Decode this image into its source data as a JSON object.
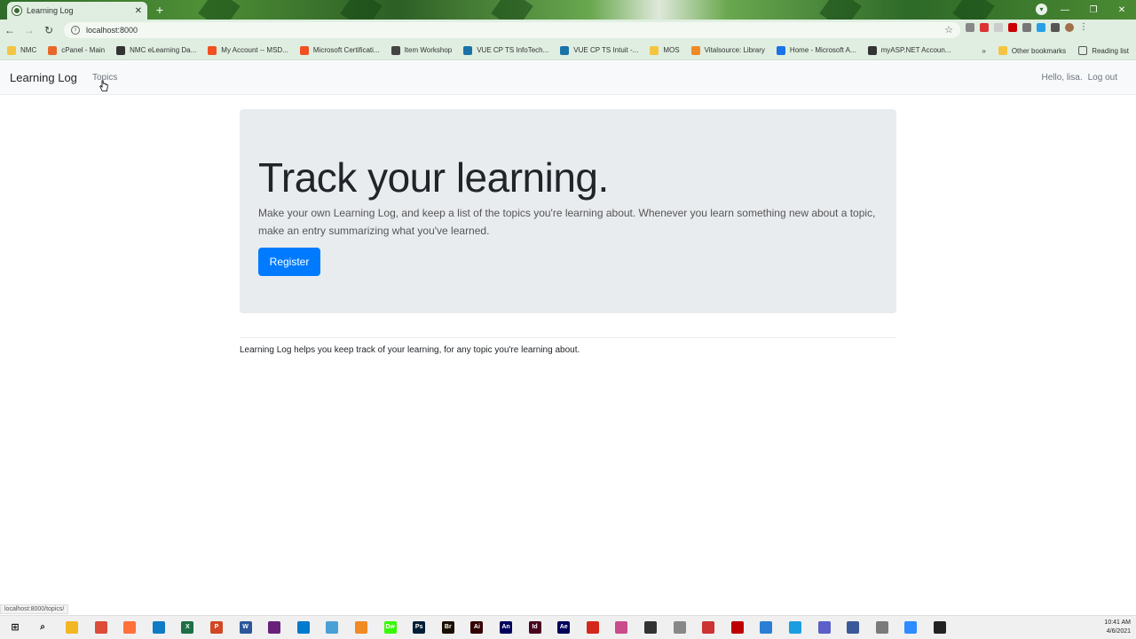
{
  "browser": {
    "tab_title": "Learning Log",
    "tab_close": "✕",
    "new_tab": "+",
    "url": "localhost:8000",
    "status_url": "localhost:8000/topics/",
    "bookmarks": [
      {
        "label": "NMC",
        "color": "#f4c542"
      },
      {
        "label": "cPanel - Main",
        "color": "#e8682b"
      },
      {
        "label": "NMC eLearning Da...",
        "color": "#333333"
      },
      {
        "label": "My Account -- MSD...",
        "color": "#f25022"
      },
      {
        "label": "Microsoft Certificati...",
        "color": "#f25022"
      },
      {
        "label": "Item Workshop",
        "color": "#444444"
      },
      {
        "label": "VUE CP TS InfoTech...",
        "color": "#1a73a8"
      },
      {
        "label": "VUE CP TS Intuit -...",
        "color": "#1a73a8"
      },
      {
        "label": "MOS",
        "color": "#f4c542"
      },
      {
        "label": "Vitalsource: Library",
        "color": "#f08a24"
      },
      {
        "label": "Home - Microsoft A...",
        "color": "#1a73e8"
      },
      {
        "label": "myASP.NET Accoun...",
        "color": "#333333"
      }
    ],
    "bookmarks_more": "»",
    "other_bookmarks": "Other bookmarks",
    "reading_list": "Reading list"
  },
  "navbar": {
    "brand": "Learning Log",
    "topics": "Topics",
    "greeting": "Hello, lisa.",
    "logout": "Log out"
  },
  "jumbotron": {
    "heading": "Track your learning.",
    "lead": "Make your own Learning Log, and keep a list of the topics you're learning about. Whenever you learn something new about a topic, make an entry summarizing what you've learned.",
    "register": "Register"
  },
  "footer": {
    "text": "Learning Log helps you keep track of your learning, for any topic you're learning about."
  },
  "taskbar": {
    "time": "10:41 AM",
    "date": "4/6/2021",
    "apps": [
      {
        "name": "file-explorer",
        "label": "",
        "color": "#f2b824"
      },
      {
        "name": "chrome",
        "label": "",
        "color": "#dd4b39"
      },
      {
        "name": "firefox",
        "label": "",
        "color": "#ff7139"
      },
      {
        "name": "edge",
        "label": "",
        "color": "#0f7bc4"
      },
      {
        "name": "excel",
        "label": "X",
        "color": "#1d7044"
      },
      {
        "name": "powerpoint",
        "label": "P",
        "color": "#d24726"
      },
      {
        "name": "word",
        "label": "W",
        "color": "#2b579a"
      },
      {
        "name": "visual-studio",
        "label": "",
        "color": "#68217a"
      },
      {
        "name": "vscode",
        "label": "",
        "color": "#007acc"
      },
      {
        "name": "app-tool",
        "label": "",
        "color": "#4aa0d5"
      },
      {
        "name": "sublime",
        "label": "",
        "color": "#f08a24"
      },
      {
        "name": "dreamweaver",
        "label": "Dw",
        "color": "#35fa00"
      },
      {
        "name": "photoshop",
        "label": "Ps",
        "color": "#001e36"
      },
      {
        "name": "bridge",
        "label": "Br",
        "color": "#1a0e00"
      },
      {
        "name": "illustrator",
        "label": "Ai",
        "color": "#330000"
      },
      {
        "name": "animate",
        "label": "An",
        "color": "#00005b"
      },
      {
        "name": "indesign",
        "label": "Id",
        "color": "#49021f"
      },
      {
        "name": "after-effects",
        "label": "Ae",
        "color": "#00005b"
      },
      {
        "name": "acrobat",
        "label": "",
        "color": "#d4271b"
      },
      {
        "name": "app-2",
        "label": "",
        "color": "#c94c8b"
      },
      {
        "name": "app-3",
        "label": "",
        "color": "#333333"
      },
      {
        "name": "app-4",
        "label": "",
        "color": "#888888"
      },
      {
        "name": "app-5",
        "label": "",
        "color": "#cc3333"
      },
      {
        "name": "filezilla",
        "label": "",
        "color": "#bf0000"
      },
      {
        "name": "app-6",
        "label": "",
        "color": "#2a7fd4"
      },
      {
        "name": "app-7",
        "label": "",
        "color": "#1b9de2"
      },
      {
        "name": "teams",
        "label": "",
        "color": "#5b5fc7"
      },
      {
        "name": "app-8",
        "label": "",
        "color": "#3b5998"
      },
      {
        "name": "app-9",
        "label": "",
        "color": "#7a7a7a"
      },
      {
        "name": "zoom",
        "label": "",
        "color": "#2d8cff"
      },
      {
        "name": "terminal",
        "label": "",
        "color": "#222222"
      }
    ]
  },
  "colors": {
    "primary": "#007bff",
    "jumbotron_bg": "#e9ecef",
    "navbar_bg": "#f8f9fa"
  }
}
